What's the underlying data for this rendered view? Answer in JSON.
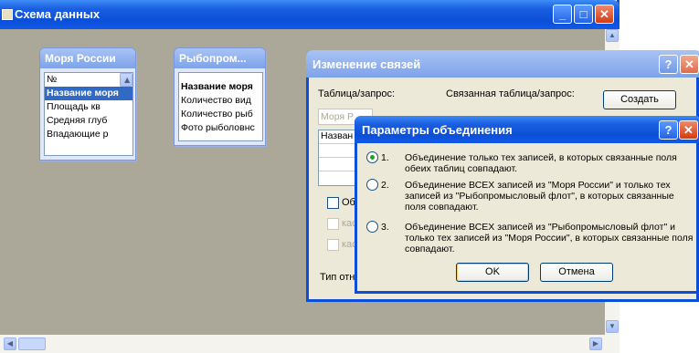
{
  "main_window": {
    "title": "Схема данных",
    "minimize": "_",
    "maximize": "□",
    "close": "✕"
  },
  "tables": [
    {
      "title": "Моря России",
      "fields": [
        "№",
        "Название моря",
        "Площадь кв",
        "Средняя глуб",
        "Впадающие р"
      ]
    },
    {
      "title": "Рыбопром...",
      "fields": [
        "Название моря",
        "Количество вид",
        "Количество рыб",
        "Фото рыболовнс"
      ]
    }
  ],
  "relations_dialog": {
    "title": "Изменение связей",
    "help": "?",
    "close": "✕",
    "table_label": "Таблица/запрос:",
    "related_label": "Связанная таблица/запрос:",
    "create_button": "Создать",
    "table_value": "Моря Р",
    "grid_first": "Назван",
    "enforce_label": "Об",
    "cascade1": "кас",
    "cascade2": "кас",
    "rel_type_label": "Тип отн"
  },
  "join_dialog": {
    "title": "Параметры объединения",
    "help": "?",
    "close": "✕",
    "options": [
      {
        "num": "1.",
        "text": "Объединение только тех записей, в которых связанные поля обеих таблиц совпадают.",
        "selected": true
      },
      {
        "num": "2.",
        "text": "Объединение ВСЕХ записей из \"Моря России\" и только тех записей из \"Рыбопромысловый флот\", в которых связанные поля совпадают.",
        "selected": false
      },
      {
        "num": "3.",
        "text": "Объединение ВСЕХ записей из \"Рыбопромысловый флот\" и только тех записей из \"Моря России\", в которых связанные поля совпадают.",
        "selected": false
      }
    ],
    "ok": "OK",
    "cancel": "Отмена"
  },
  "colors": {
    "xp_blue": "#0b4fd8",
    "workspace": "#aca899",
    "selection": "#316ac5"
  }
}
